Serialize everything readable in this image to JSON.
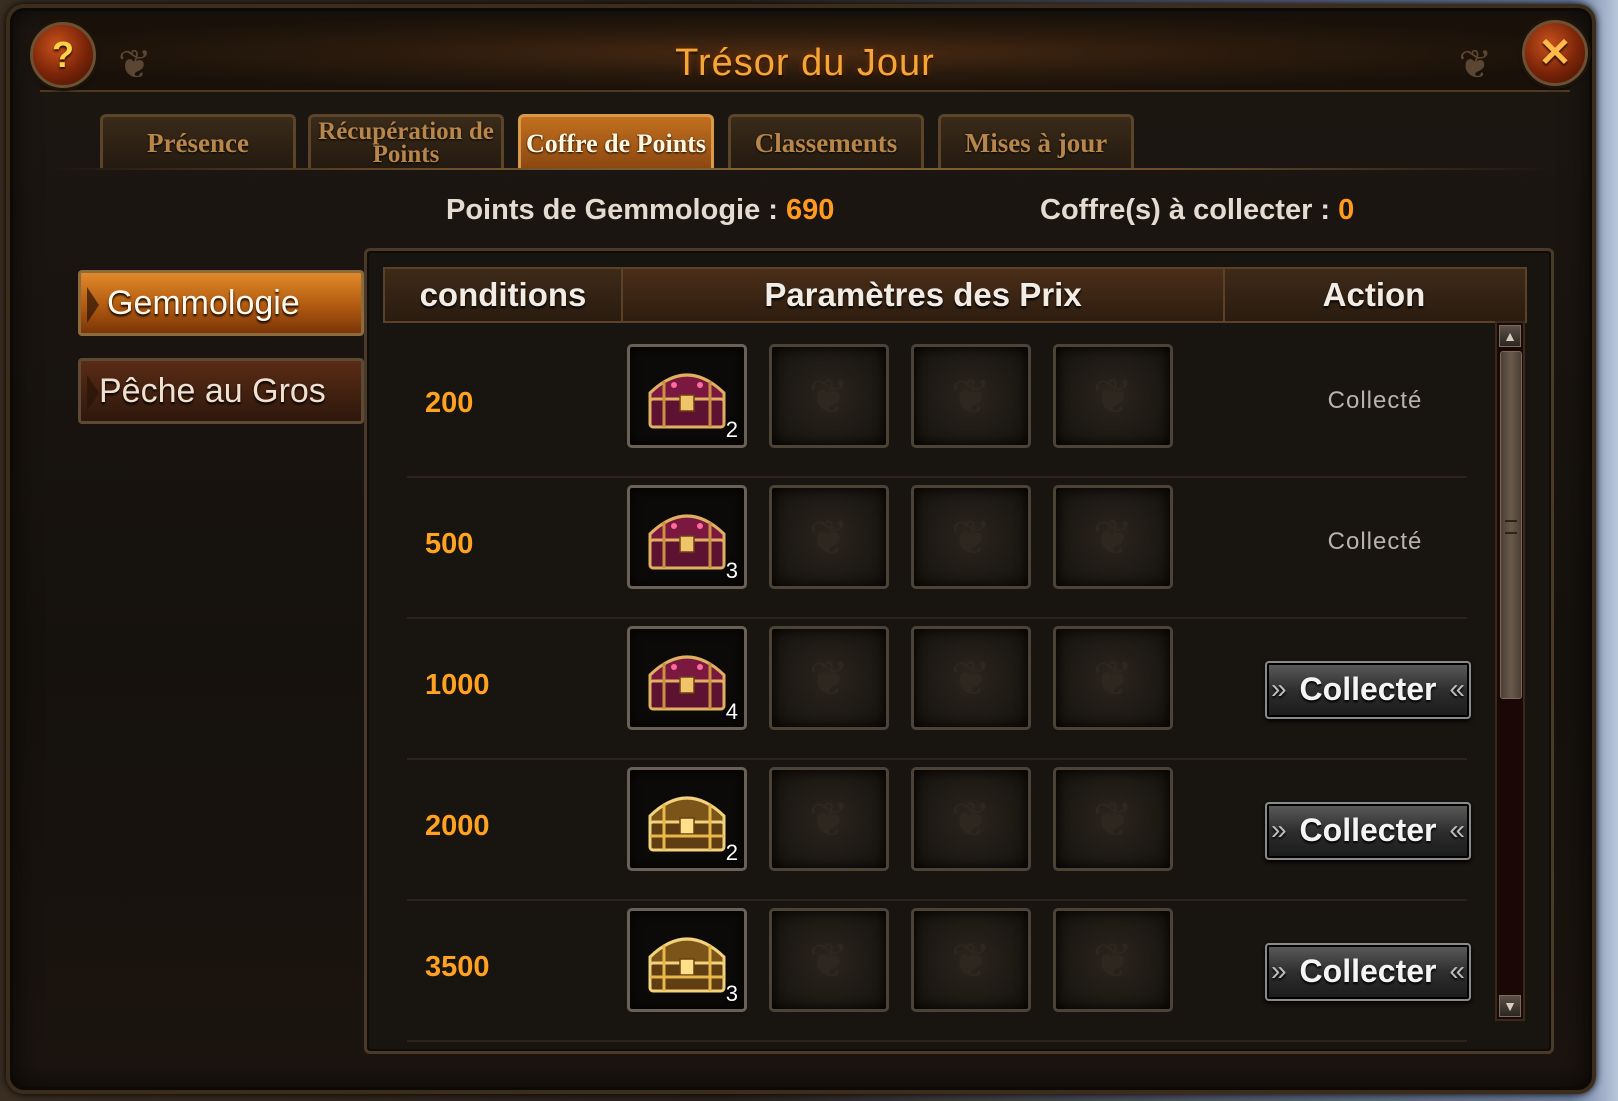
{
  "window": {
    "title": "Trésor du Jour",
    "help_icon": "?",
    "close_icon": "✕"
  },
  "tabs": [
    {
      "label": "Présence",
      "active": false
    },
    {
      "label": "Récupération de Points",
      "active": false
    },
    {
      "label": "Coffre de Points",
      "active": true
    },
    {
      "label": "Classements",
      "active": false
    },
    {
      "label": "Mises à jour",
      "active": false
    }
  ],
  "stats": {
    "points_label": "Points de Gemmologie : ",
    "points_value": "690",
    "chests_label": "Coffre(s) à collecter : ",
    "chests_value": "0"
  },
  "sidebar": [
    {
      "label": "Gemmologie",
      "active": true
    },
    {
      "label": "Pêche au Gros",
      "active": false
    }
  ],
  "table": {
    "headers": {
      "conditions": "conditions",
      "prizes": "Paramètres des Prix",
      "action": "Action"
    },
    "rows": [
      {
        "condition": "200",
        "chest": "purple-chest-icon",
        "qty": "2",
        "status": "Collecté"
      },
      {
        "condition": "500",
        "chest": "purple-chest-icon",
        "qty": "3",
        "status": "Collecté"
      },
      {
        "condition": "1000",
        "chest": "purple-chest-icon",
        "qty": "4",
        "button": "Collecter"
      },
      {
        "condition": "2000",
        "chest": "gold-chest-icon",
        "qty": "2",
        "button": "Collecter"
      },
      {
        "condition": "3500",
        "chest": "gold-chest-icon",
        "qty": "3",
        "button": "Collecter"
      }
    ]
  },
  "colors": {
    "accent_orange": "#ffa21f",
    "title_orange": "#f5a636",
    "purple_chest": "#8a1c4a",
    "gold_chest": "#c8962a"
  }
}
